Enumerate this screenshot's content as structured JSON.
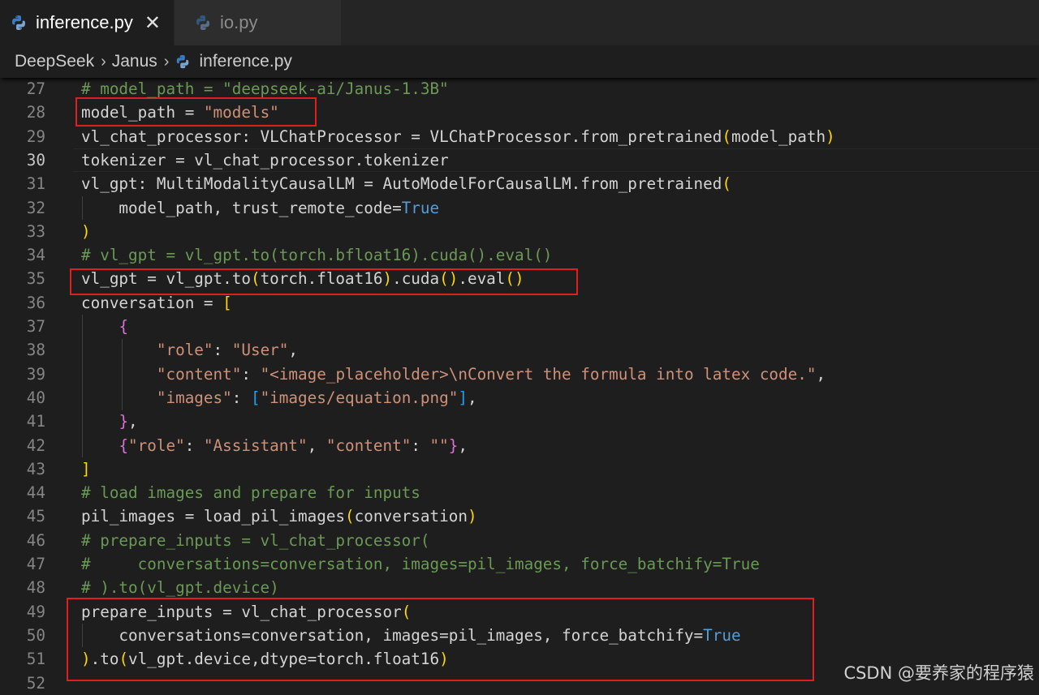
{
  "tabs": [
    {
      "label": "inference.py",
      "active": true,
      "icon": "python-icon"
    },
    {
      "label": "io.py",
      "active": false,
      "icon": "python-icon"
    }
  ],
  "tab_close_glyph": "✕",
  "breadcrumbs": [
    "DeepSeek",
    "Janus",
    "inference.py"
  ],
  "breadcrumb_separator": "›",
  "watermark": "CSDN @要养家的程序猿",
  "colors": {
    "editor_bg": "#1e1e1e",
    "highlight_box": "#e02020",
    "comment": "#6a9955",
    "string": "#ce9178",
    "keyword": "#569cd6"
  },
  "current_line": 30,
  "lines": [
    {
      "num": "27",
      "tokens": [
        [
          "com",
          "# model_path = \"deepseek-ai/Janus-1.3B\""
        ]
      ]
    },
    {
      "num": "28",
      "tokens": [
        [
          "plain",
          "model_path = "
        ],
        [
          "str",
          "\"models\""
        ]
      ]
    },
    {
      "num": "29",
      "tokens": [
        [
          "plain",
          "vl_chat_processor: VLChatProcessor = VLChatProcessor.from_pretrained"
        ],
        [
          "b1",
          "("
        ],
        [
          "plain",
          "model_path"
        ],
        [
          "b1",
          ")"
        ]
      ]
    },
    {
      "num": "30",
      "tokens": [
        [
          "plain",
          "tokenizer = vl_chat_processor.tokenizer"
        ]
      ]
    },
    {
      "num": "31",
      "tokens": [
        [
          "plain",
          "vl_gpt: MultiModalityCausalLM = AutoModelForCausalLM.from_pretrained"
        ],
        [
          "b1",
          "("
        ]
      ]
    },
    {
      "num": "32",
      "tokens": [
        [
          "plain",
          "    model_path, trust_remote_code="
        ],
        [
          "kw",
          "True"
        ]
      ]
    },
    {
      "num": "33",
      "tokens": [
        [
          "b1",
          ")"
        ]
      ]
    },
    {
      "num": "34",
      "tokens": [
        [
          "com",
          "# vl_gpt = vl_gpt.to(torch.bfloat16).cuda().eval()"
        ]
      ]
    },
    {
      "num": "35",
      "tokens": [
        [
          "plain",
          "vl_gpt = vl_gpt.to"
        ],
        [
          "b1",
          "("
        ],
        [
          "plain",
          "torch.float16"
        ],
        [
          "b1",
          ")"
        ],
        [
          "plain",
          ".cuda"
        ],
        [
          "b1",
          "()"
        ],
        [
          "plain",
          ".eval"
        ],
        [
          "b1",
          "()"
        ]
      ]
    },
    {
      "num": "36",
      "tokens": [
        [
          "plain",
          "conversation = "
        ],
        [
          "b1",
          "["
        ]
      ]
    },
    {
      "num": "37",
      "tokens": [
        [
          "plain",
          "    "
        ],
        [
          "b2",
          "{"
        ]
      ]
    },
    {
      "num": "38",
      "tokens": [
        [
          "plain",
          "        "
        ],
        [
          "str",
          "\"role\""
        ],
        [
          "plain",
          ": "
        ],
        [
          "str",
          "\"User\""
        ],
        [
          "plain",
          ","
        ]
      ]
    },
    {
      "num": "39",
      "tokens": [
        [
          "plain",
          "        "
        ],
        [
          "str",
          "\"content\""
        ],
        [
          "plain",
          ": "
        ],
        [
          "str",
          "\"<image_placeholder>\\nConvert the formula into latex code.\""
        ],
        [
          "plain",
          ","
        ]
      ]
    },
    {
      "num": "40",
      "tokens": [
        [
          "plain",
          "        "
        ],
        [
          "str",
          "\"images\""
        ],
        [
          "plain",
          ": "
        ],
        [
          "b3",
          "["
        ],
        [
          "str",
          "\"images/equation.png\""
        ],
        [
          "b3",
          "]"
        ],
        [
          "plain",
          ","
        ]
      ]
    },
    {
      "num": "41",
      "tokens": [
        [
          "plain",
          "    "
        ],
        [
          "b2",
          "}"
        ],
        [
          "plain",
          ","
        ]
      ]
    },
    {
      "num": "42",
      "tokens": [
        [
          "plain",
          "    "
        ],
        [
          "b2",
          "{"
        ],
        [
          "str",
          "\"role\""
        ],
        [
          "plain",
          ": "
        ],
        [
          "str",
          "\"Assistant\""
        ],
        [
          "plain",
          ", "
        ],
        [
          "str",
          "\"content\""
        ],
        [
          "plain",
          ": "
        ],
        [
          "str",
          "\"\""
        ],
        [
          "b2",
          "}"
        ],
        [
          "plain",
          ","
        ]
      ]
    },
    {
      "num": "43",
      "tokens": [
        [
          "b1",
          "]"
        ]
      ]
    },
    {
      "num": "44",
      "tokens": [
        [
          "com",
          "# load images and prepare for inputs"
        ]
      ]
    },
    {
      "num": "45",
      "tokens": [
        [
          "plain",
          "pil_images = load_pil_images"
        ],
        [
          "b1",
          "("
        ],
        [
          "plain",
          "conversation"
        ],
        [
          "b1",
          ")"
        ]
      ]
    },
    {
      "num": "46",
      "tokens": [
        [
          "com",
          "# prepare_inputs = vl_chat_processor("
        ]
      ]
    },
    {
      "num": "47",
      "tokens": [
        [
          "com",
          "#     conversations=conversation, images=pil_images, force_batchify=True"
        ]
      ]
    },
    {
      "num": "48",
      "tokens": [
        [
          "com",
          "# ).to(vl_gpt.device)"
        ]
      ]
    },
    {
      "num": "49",
      "tokens": [
        [
          "plain",
          "prepare_inputs = vl_chat_processor"
        ],
        [
          "b1",
          "("
        ]
      ]
    },
    {
      "num": "50",
      "tokens": [
        [
          "plain",
          "    conversations=conversation, images=pil_images, force_batchify="
        ],
        [
          "kw",
          "True"
        ]
      ]
    },
    {
      "num": "51",
      "tokens": [
        [
          "b1",
          ")"
        ],
        [
          "plain",
          ".to"
        ],
        [
          "b1",
          "("
        ],
        [
          "plain",
          "vl_gpt.device,dtype=torch.float16"
        ],
        [
          "b1",
          ")"
        ]
      ]
    },
    {
      "num": "52",
      "tokens": [
        [
          "plain",
          ""
        ]
      ]
    }
  ]
}
